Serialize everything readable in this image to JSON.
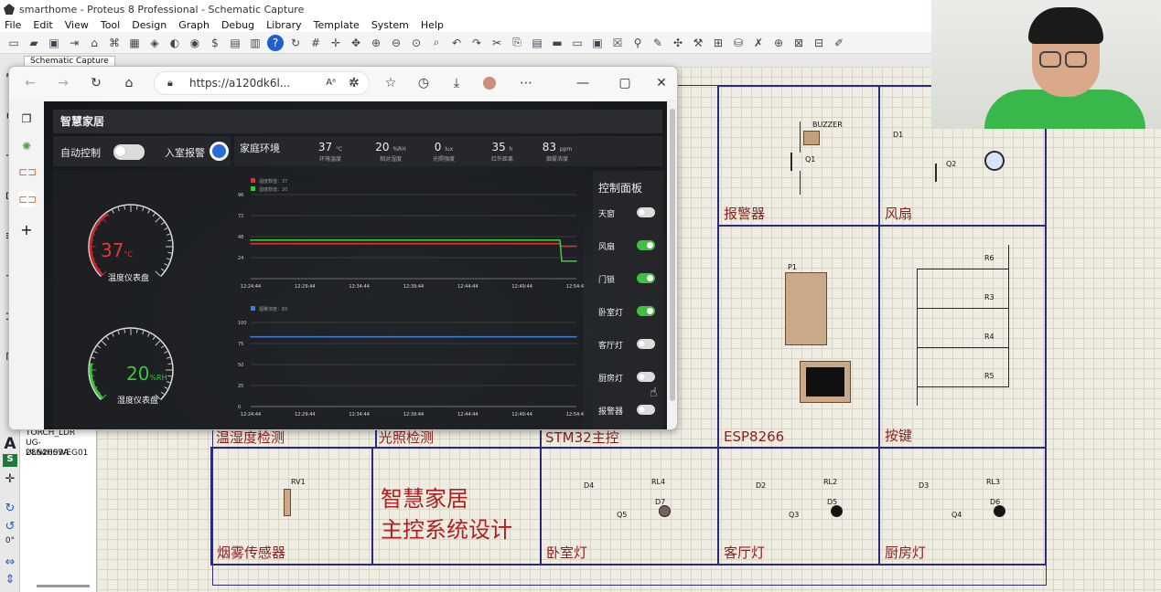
{
  "window": {
    "title": "smarthome - Proteus 8 Professional - Schematic Capture"
  },
  "menu": [
    "File",
    "Edit",
    "View",
    "Tool",
    "Design",
    "Graph",
    "Debug",
    "Library",
    "Template",
    "System",
    "Help"
  ],
  "tab": {
    "label": "Schematic Capture"
  },
  "device_list": [
    "TORCH_LDR",
    "UG-2864HSWEG01",
    "ULN2003A"
  ],
  "rotation_value": "0°",
  "schematic": {
    "cells": {
      "alarm": "报警器",
      "fan": "风扇",
      "esp": "ESP8266",
      "keys": "按键",
      "temp": "温湿度检测",
      "light": "光照检测",
      "stm32": "STM32主控",
      "smoke": "烟雾传感器",
      "bedroom": "卧室灯",
      "living": "客厅灯",
      "kitchen": "厨房灯"
    },
    "project_title_line1": "智慧家居",
    "project_title_line2": "主控系统设计",
    "components": {
      "buzzer": "BUZZER",
      "q1": "Q1",
      "q2": "Q2",
      "d1": "D1",
      "p1": "P1",
      "rv1": "RV1",
      "rl4": "RL4",
      "rl2": "RL2",
      "rl3": "RL3",
      "d4": "D4",
      "d2": "D2",
      "d3": "D3",
      "q5": "Q5",
      "q3": "Q3",
      "q4": "Q4",
      "d7": "D7",
      "d5": "D5",
      "d6": "D6",
      "r6": "R6",
      "r3": "R3",
      "r4": "R4",
      "r5": "R5"
    }
  },
  "browser": {
    "url": "https://a120dk6l...",
    "dashboard": {
      "title": "智慧家居",
      "auto_control": {
        "label": "自动控制",
        "on": false
      },
      "intrusion_alarm": {
        "label": "入室报警",
        "on": true
      },
      "env_label": "家庭环境",
      "env": [
        {
          "value": "37",
          "unit": "°C",
          "label": "环境温度"
        },
        {
          "value": "20",
          "unit": "%RH",
          "label": "相对湿度"
        },
        {
          "value": "0",
          "unit": "lux",
          "label": "光照强度"
        },
        {
          "value": "35",
          "unit": "h",
          "label": "红外距离"
        },
        {
          "value": "83",
          "unit": "ppm",
          "label": "烟雾浓度"
        }
      ],
      "temp_gauge": {
        "value": "37",
        "unit": "°C",
        "label": "温度仪表盘",
        "fraction": 0.37
      },
      "hum_gauge": {
        "value": "20",
        "unit": "%RH",
        "label": "湿度仪表盘",
        "fraction": 0.2
      },
      "control_panel": {
        "title": "控制面板",
        "items": [
          {
            "label": "天窗",
            "on": false
          },
          {
            "label": "风扇",
            "on": true
          },
          {
            "label": "门锁",
            "on": true
          },
          {
            "label": "卧室灯",
            "on": true
          },
          {
            "label": "客厅灯",
            "on": false
          },
          {
            "label": "厨房灯",
            "on": false
          },
          {
            "label": "报警器",
            "on": false
          }
        ]
      }
    }
  },
  "chart_data": [
    {
      "type": "line",
      "title": "",
      "x": [
        "12:24:44",
        "12:29:44",
        "12:34:44",
        "12:39:44",
        "12:44:44",
        "12:49:44",
        "12:54:44"
      ],
      "yticks": [
        24,
        48,
        72,
        96
      ],
      "ylim": [
        0,
        96
      ],
      "series": [
        {
          "name": "温度数值：37",
          "color": "#e03030",
          "values": [
            40,
            40,
            40,
            40,
            40,
            40,
            37
          ]
        },
        {
          "name": "湿度数值：20",
          "color": "#3ec23e",
          "values": [
            44,
            44,
            44,
            44,
            44,
            44,
            20
          ]
        }
      ]
    },
    {
      "type": "line",
      "title": "",
      "x": [
        "12:24:44",
        "12:29:44",
        "12:34:44",
        "12:39:44",
        "12:44:44",
        "12:49:44",
        "12:54:44"
      ],
      "yticks": [
        0,
        25,
        50,
        75,
        100
      ],
      "ylim": [
        0,
        100
      ],
      "series": [
        {
          "name": "烟雾浓度：83",
          "color": "#3d7dd8",
          "values": [
            83,
            83,
            83,
            83,
            83,
            83,
            83
          ]
        }
      ]
    }
  ]
}
